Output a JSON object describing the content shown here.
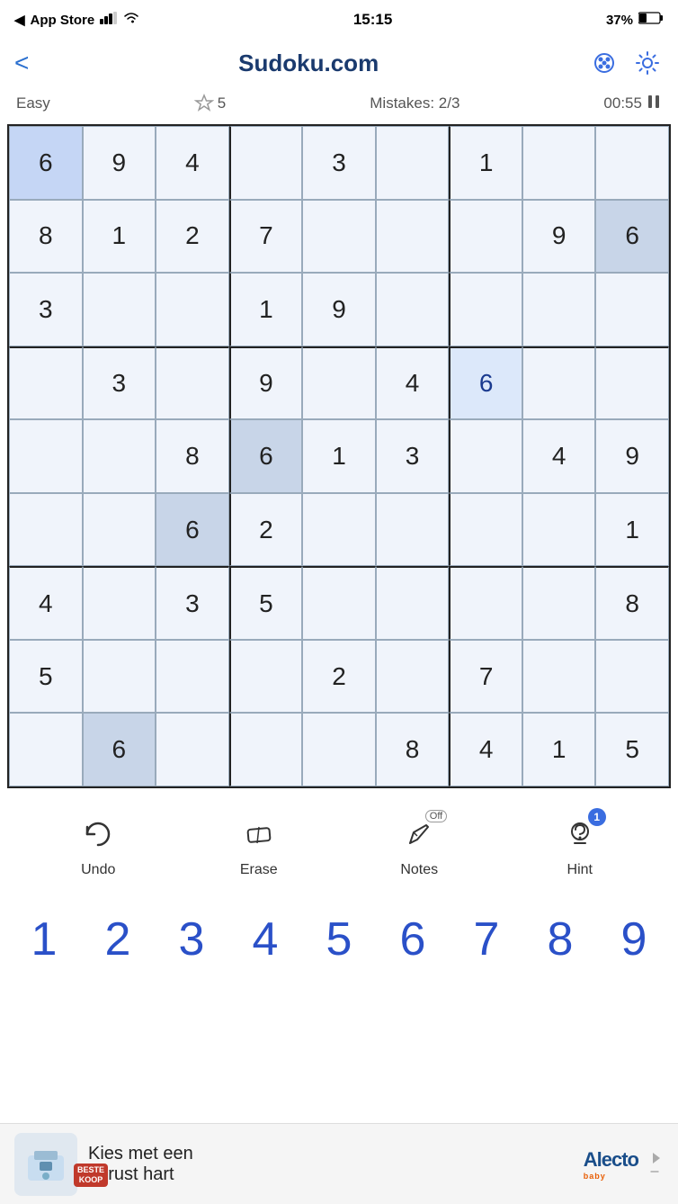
{
  "statusBar": {
    "carrier": "App Store",
    "time": "15:15",
    "battery": "37%",
    "signal": "●●"
  },
  "header": {
    "title": "Sudoku.com",
    "backLabel": "<",
    "paletteIcon": "palette-icon",
    "settingsIcon": "settings-icon"
  },
  "gameInfo": {
    "difficulty": "Easy",
    "stars": "5",
    "mistakesLabel": "Mistakes: 2/3",
    "timer": "00:55",
    "pauseIcon": "pause-icon"
  },
  "grid": {
    "cells": [
      {
        "row": 0,
        "col": 0,
        "value": "6",
        "type": "given",
        "state": "selected"
      },
      {
        "row": 0,
        "col": 1,
        "value": "9",
        "type": "given",
        "state": "normal"
      },
      {
        "row": 0,
        "col": 2,
        "value": "4",
        "type": "given",
        "state": "normal"
      },
      {
        "row": 0,
        "col": 3,
        "value": "",
        "type": "empty",
        "state": "normal"
      },
      {
        "row": 0,
        "col": 4,
        "value": "3",
        "type": "given",
        "state": "normal"
      },
      {
        "row": 0,
        "col": 5,
        "value": "",
        "type": "empty",
        "state": "normal"
      },
      {
        "row": 0,
        "col": 6,
        "value": "1",
        "type": "given",
        "state": "normal"
      },
      {
        "row": 0,
        "col": 7,
        "value": "",
        "type": "empty",
        "state": "normal"
      },
      {
        "row": 0,
        "col": 8,
        "value": "",
        "type": "empty",
        "state": "normal"
      },
      {
        "row": 1,
        "col": 0,
        "value": "8",
        "type": "given",
        "state": "normal"
      },
      {
        "row": 1,
        "col": 1,
        "value": "1",
        "type": "given",
        "state": "normal"
      },
      {
        "row": 1,
        "col": 2,
        "value": "2",
        "type": "given",
        "state": "normal"
      },
      {
        "row": 1,
        "col": 3,
        "value": "7",
        "type": "given",
        "state": "normal"
      },
      {
        "row": 1,
        "col": 4,
        "value": "",
        "type": "empty",
        "state": "normal"
      },
      {
        "row": 1,
        "col": 5,
        "value": "",
        "type": "empty",
        "state": "normal"
      },
      {
        "row": 1,
        "col": 6,
        "value": "",
        "type": "empty",
        "state": "normal"
      },
      {
        "row": 1,
        "col": 7,
        "value": "9",
        "type": "given",
        "state": "normal"
      },
      {
        "row": 1,
        "col": 8,
        "value": "6",
        "type": "given",
        "state": "darker"
      },
      {
        "row": 2,
        "col": 0,
        "value": "3",
        "type": "given",
        "state": "normal"
      },
      {
        "row": 2,
        "col": 1,
        "value": "",
        "type": "empty",
        "state": "normal"
      },
      {
        "row": 2,
        "col": 2,
        "value": "",
        "type": "empty",
        "state": "normal"
      },
      {
        "row": 2,
        "col": 3,
        "value": "1",
        "type": "given",
        "state": "normal"
      },
      {
        "row": 2,
        "col": 4,
        "value": "9",
        "type": "given",
        "state": "normal"
      },
      {
        "row": 2,
        "col": 5,
        "value": "",
        "type": "empty",
        "state": "normal"
      },
      {
        "row": 2,
        "col": 6,
        "value": "",
        "type": "empty",
        "state": "normal"
      },
      {
        "row": 2,
        "col": 7,
        "value": "",
        "type": "empty",
        "state": "normal"
      },
      {
        "row": 2,
        "col": 8,
        "value": "",
        "type": "empty",
        "state": "normal"
      },
      {
        "row": 3,
        "col": 0,
        "value": "",
        "type": "empty",
        "state": "normal"
      },
      {
        "row": 3,
        "col": 1,
        "value": "3",
        "type": "given",
        "state": "normal"
      },
      {
        "row": 3,
        "col": 2,
        "value": "",
        "type": "empty",
        "state": "normal"
      },
      {
        "row": 3,
        "col": 3,
        "value": "9",
        "type": "given",
        "state": "normal"
      },
      {
        "row": 3,
        "col": 4,
        "value": "",
        "type": "empty",
        "state": "normal"
      },
      {
        "row": 3,
        "col": 5,
        "value": "4",
        "type": "given",
        "state": "normal"
      },
      {
        "row": 3,
        "col": 6,
        "value": "6",
        "type": "user",
        "state": "highlighted"
      },
      {
        "row": 3,
        "col": 7,
        "value": "",
        "type": "empty",
        "state": "normal"
      },
      {
        "row": 3,
        "col": 8,
        "value": "",
        "type": "empty",
        "state": "normal"
      },
      {
        "row": 4,
        "col": 0,
        "value": "",
        "type": "empty",
        "state": "normal"
      },
      {
        "row": 4,
        "col": 1,
        "value": "",
        "type": "empty",
        "state": "normal"
      },
      {
        "row": 4,
        "col": 2,
        "value": "8",
        "type": "given",
        "state": "normal"
      },
      {
        "row": 4,
        "col": 3,
        "value": "6",
        "type": "given",
        "state": "darker"
      },
      {
        "row": 4,
        "col": 4,
        "value": "1",
        "type": "given",
        "state": "normal"
      },
      {
        "row": 4,
        "col": 5,
        "value": "3",
        "type": "given",
        "state": "normal"
      },
      {
        "row": 4,
        "col": 6,
        "value": "",
        "type": "empty",
        "state": "normal"
      },
      {
        "row": 4,
        "col": 7,
        "value": "4",
        "type": "given",
        "state": "normal"
      },
      {
        "row": 4,
        "col": 8,
        "value": "9",
        "type": "given",
        "state": "normal"
      },
      {
        "row": 5,
        "col": 0,
        "value": "",
        "type": "empty",
        "state": "normal"
      },
      {
        "row": 5,
        "col": 1,
        "value": "",
        "type": "empty",
        "state": "normal"
      },
      {
        "row": 5,
        "col": 2,
        "value": "6",
        "type": "given",
        "state": "darker"
      },
      {
        "row": 5,
        "col": 3,
        "value": "2",
        "type": "given",
        "state": "normal"
      },
      {
        "row": 5,
        "col": 4,
        "value": "",
        "type": "empty",
        "state": "normal"
      },
      {
        "row": 5,
        "col": 5,
        "value": "",
        "type": "empty",
        "state": "normal"
      },
      {
        "row": 5,
        "col": 6,
        "value": "",
        "type": "empty",
        "state": "normal"
      },
      {
        "row": 5,
        "col": 7,
        "value": "",
        "type": "empty",
        "state": "normal"
      },
      {
        "row": 5,
        "col": 8,
        "value": "1",
        "type": "given",
        "state": "normal"
      },
      {
        "row": 6,
        "col": 0,
        "value": "4",
        "type": "given",
        "state": "normal"
      },
      {
        "row": 6,
        "col": 1,
        "value": "",
        "type": "empty",
        "state": "normal"
      },
      {
        "row": 6,
        "col": 2,
        "value": "3",
        "type": "given",
        "state": "normal"
      },
      {
        "row": 6,
        "col": 3,
        "value": "5",
        "type": "given",
        "state": "normal"
      },
      {
        "row": 6,
        "col": 4,
        "value": "",
        "type": "empty",
        "state": "normal"
      },
      {
        "row": 6,
        "col": 5,
        "value": "",
        "type": "empty",
        "state": "normal"
      },
      {
        "row": 6,
        "col": 6,
        "value": "",
        "type": "empty",
        "state": "normal"
      },
      {
        "row": 6,
        "col": 7,
        "value": "",
        "type": "empty",
        "state": "normal"
      },
      {
        "row": 6,
        "col": 8,
        "value": "8",
        "type": "given",
        "state": "normal"
      },
      {
        "row": 7,
        "col": 0,
        "value": "5",
        "type": "given",
        "state": "normal"
      },
      {
        "row": 7,
        "col": 1,
        "value": "",
        "type": "empty",
        "state": "normal"
      },
      {
        "row": 7,
        "col": 2,
        "value": "",
        "type": "empty",
        "state": "normal"
      },
      {
        "row": 7,
        "col": 3,
        "value": "",
        "type": "empty",
        "state": "normal"
      },
      {
        "row": 7,
        "col": 4,
        "value": "2",
        "type": "given",
        "state": "normal"
      },
      {
        "row": 7,
        "col": 5,
        "value": "",
        "type": "empty",
        "state": "normal"
      },
      {
        "row": 7,
        "col": 6,
        "value": "7",
        "type": "given",
        "state": "normal"
      },
      {
        "row": 7,
        "col": 7,
        "value": "",
        "type": "empty",
        "state": "normal"
      },
      {
        "row": 7,
        "col": 8,
        "value": "",
        "type": "empty",
        "state": "normal"
      },
      {
        "row": 8,
        "col": 0,
        "value": "",
        "type": "empty",
        "state": "normal"
      },
      {
        "row": 8,
        "col": 1,
        "value": "6",
        "type": "given",
        "state": "darker"
      },
      {
        "row": 8,
        "col": 2,
        "value": "",
        "type": "empty",
        "state": "normal"
      },
      {
        "row": 8,
        "col": 3,
        "value": "",
        "type": "empty",
        "state": "normal"
      },
      {
        "row": 8,
        "col": 4,
        "value": "",
        "type": "empty",
        "state": "normal"
      },
      {
        "row": 8,
        "col": 5,
        "value": "8",
        "type": "given",
        "state": "normal"
      },
      {
        "row": 8,
        "col": 6,
        "value": "4",
        "type": "given",
        "state": "normal"
      },
      {
        "row": 8,
        "col": 7,
        "value": "1",
        "type": "given",
        "state": "normal"
      },
      {
        "row": 8,
        "col": 8,
        "value": "5",
        "type": "given",
        "state": "normal"
      }
    ]
  },
  "toolbar": {
    "undo": {
      "label": "Undo"
    },
    "erase": {
      "label": "Erase"
    },
    "notes": {
      "label": "Notes",
      "badge": "Off"
    },
    "hint": {
      "label": "Hint",
      "count": "1"
    }
  },
  "numpad": {
    "numbers": [
      "1",
      "2",
      "3",
      "4",
      "5",
      "6",
      "7",
      "8",
      "9"
    ]
  },
  "ad": {
    "text": "Kies met een\ngerust hart",
    "logoText": "Alecto",
    "badgeLine1": "BESTE",
    "badgeLine2": "KOOP"
  }
}
